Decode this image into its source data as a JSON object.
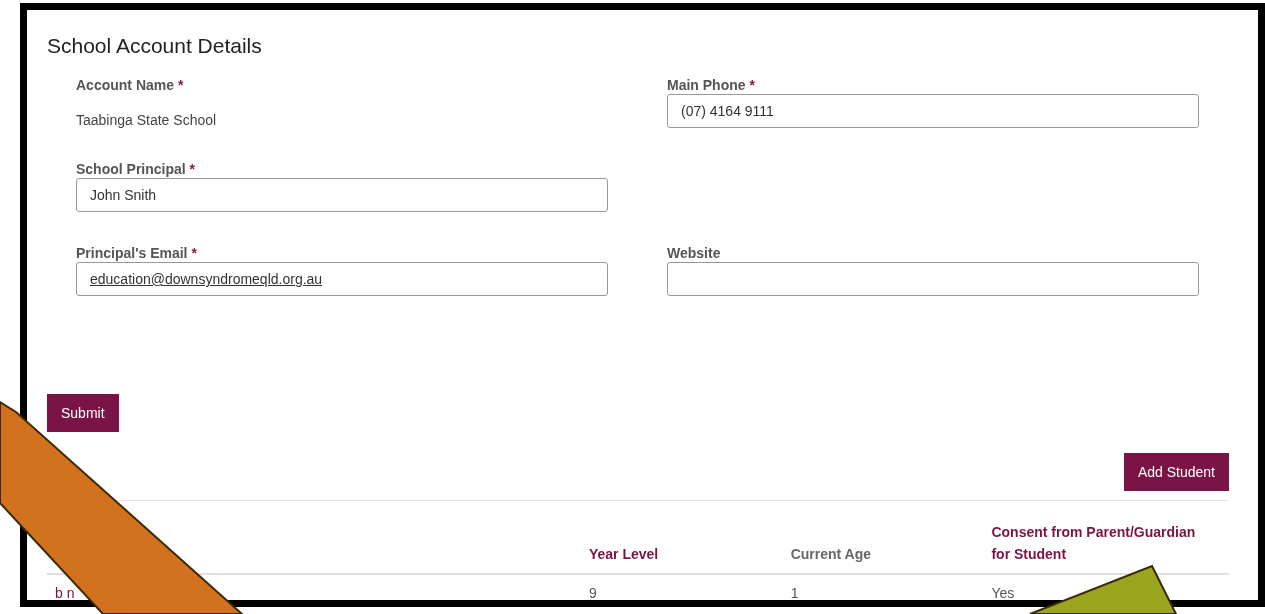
{
  "title": "School Account Details",
  "form_rows": [
    [
      {
        "label": "Account Name",
        "required_mark": "*",
        "kind": "static",
        "value": "Taabinga State School"
      },
      {
        "label": "Main Phone",
        "required_mark": "*",
        "kind": "input",
        "value": "(07) 4164 9111"
      }
    ],
    [
      {
        "label": "School Principal",
        "required_mark": "*",
        "kind": "input",
        "value": "John Snith"
      }
    ],
    [
      {
        "label": "Principal's Email",
        "required_mark": "*",
        "kind": "link-input",
        "value": "education@downsyndromeqld.org.au"
      },
      {
        "label": "Website",
        "kind": "input"
      }
    ]
  ],
  "submit_button": "Submit",
  "add_button": "Add Student",
  "table": {
    "columns": [
      {},
      {
        "label": "Year Level",
        "link": true
      },
      {
        "label": "Current Age",
        "link": false
      },
      {
        "label": "Consent from Parent/Guardian for Student",
        "link": true
      }
    ],
    "rows": [
      [
        "b n",
        "9",
        "1",
        "Yes"
      ]
    ]
  },
  "annotation_arrows": [
    {
      "kind": "band",
      "color": "#d2711e"
    },
    {
      "kind": "head",
      "color": "#9aa61e"
    }
  ]
}
